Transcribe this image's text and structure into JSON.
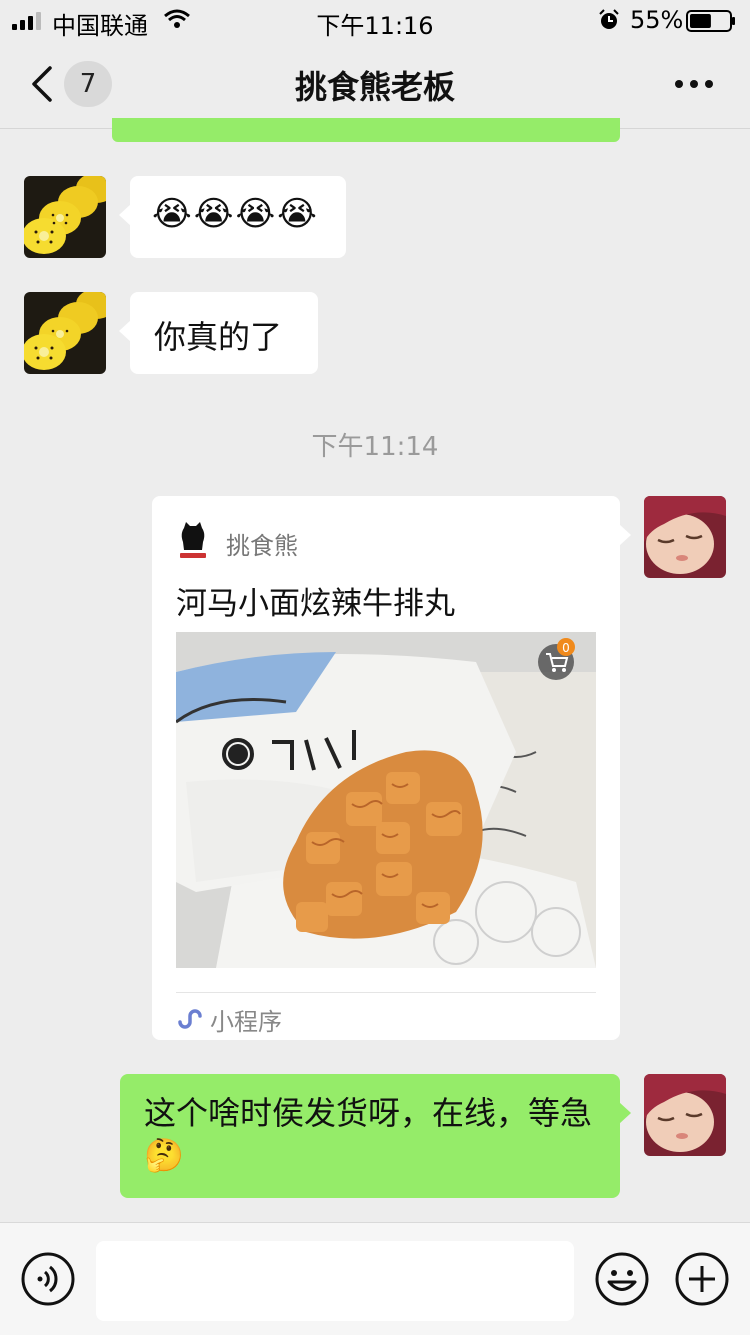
{
  "status_bar": {
    "carrier": "中国联通",
    "time": "下午11:16",
    "battery_percent": "55%",
    "battery_level": 0.55
  },
  "nav": {
    "unread_count": "7",
    "title": "挑食熊老板",
    "back_icon": "chevron-left-icon",
    "more_icon": "more-horizontal-icon"
  },
  "messages": [
    {
      "side": "left",
      "text": "😭😭😭😭"
    },
    {
      "side": "left",
      "text": "你真的了"
    },
    {
      "type": "timestamp",
      "text": "下午11:14"
    },
    {
      "side": "right",
      "type": "mini_program_card",
      "source": "挑食熊",
      "title": "河马小面炫辣牛排丸",
      "footer": "小程序",
      "cart_count": "0"
    },
    {
      "side": "right",
      "text": "这个啥时侯发货呀，在线，等急🤔"
    }
  ],
  "colors": {
    "background": "#ededed",
    "my_bubble": "#95ec69",
    "their_bubble": "#ffffff"
  },
  "input_bar": {
    "voice_icon": "voice-icon",
    "emoji_icon": "emoji-icon",
    "plus_icon": "plus-circle-icon"
  }
}
